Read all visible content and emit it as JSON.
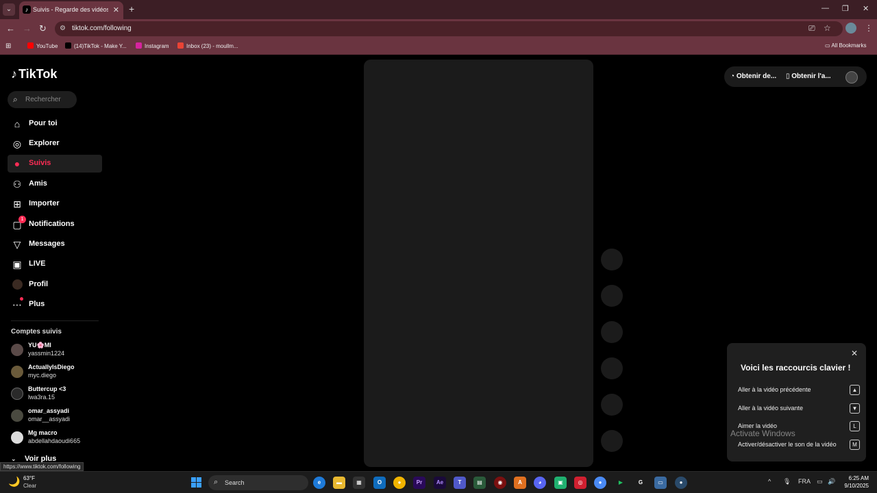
{
  "browser": {
    "tab_title": "Suivis - Regarde des vidéos de",
    "url": "tiktok.com/following",
    "bookmarks": [
      "YouTube",
      "(14)TikTok - Make Y...",
      "Instagram",
      "Inbox (23) - moullm..."
    ],
    "all_bookmarks": "All Bookmarks",
    "status_url": "https://www.tiktok.com/following"
  },
  "brand": {
    "name": "TikTok"
  },
  "search": {
    "placeholder": "Rechercher"
  },
  "nav": [
    {
      "label": "Pour toi",
      "icon": "home-icon"
    },
    {
      "label": "Explorer",
      "icon": "compass-icon"
    },
    {
      "label": "Suivis",
      "icon": "following-icon",
      "active": true
    },
    {
      "label": "Amis",
      "icon": "friends-icon"
    },
    {
      "label": "Importer",
      "icon": "upload-icon"
    },
    {
      "label": "Notifications",
      "icon": "notification-icon",
      "badge": "1"
    },
    {
      "label": "Messages",
      "icon": "messages-icon"
    },
    {
      "label": "LIVE",
      "icon": "live-icon"
    },
    {
      "label": "Profil",
      "icon": "profile-avatar-icon"
    },
    {
      "label": "Plus",
      "icon": "more-icon"
    }
  ],
  "followed": {
    "title": "Comptes suivis",
    "accounts": [
      {
        "name": "YU🌸MI",
        "username": "yassmin1224"
      },
      {
        "name": "ActuallyIsDiego",
        "username": "myc.diego"
      },
      {
        "name": "Buttercup   <3",
        "username": "lwa3ra.15"
      },
      {
        "name": "omar_assyadi",
        "username": "omar__assyadi"
      },
      {
        "name": "Mg macro",
        "username": "abdellahdaoudi665"
      }
    ],
    "see_more": "Voir plus"
  },
  "top_actions": {
    "coins": "Obtenir de...",
    "app": "Obtenir l'a..."
  },
  "shortcuts": {
    "title": "Voici les raccourcis clavier !",
    "items": [
      {
        "label": "Aller à la vidéo précédente",
        "key": "▲"
      },
      {
        "label": "Aller à la vidéo suivante",
        "key": "▼"
      },
      {
        "label": "Aimer la vidéo",
        "key": "L"
      },
      {
        "label": "Activer/désactiver le son de la vidéo",
        "key": "M"
      }
    ]
  },
  "watermark": {
    "line1": "Activate Windows"
  },
  "taskbar": {
    "temp": "63°F",
    "condition": "Clear",
    "search": "Search",
    "lang": "FRA",
    "time": "6:25 AM",
    "date": "9/10/2025"
  }
}
